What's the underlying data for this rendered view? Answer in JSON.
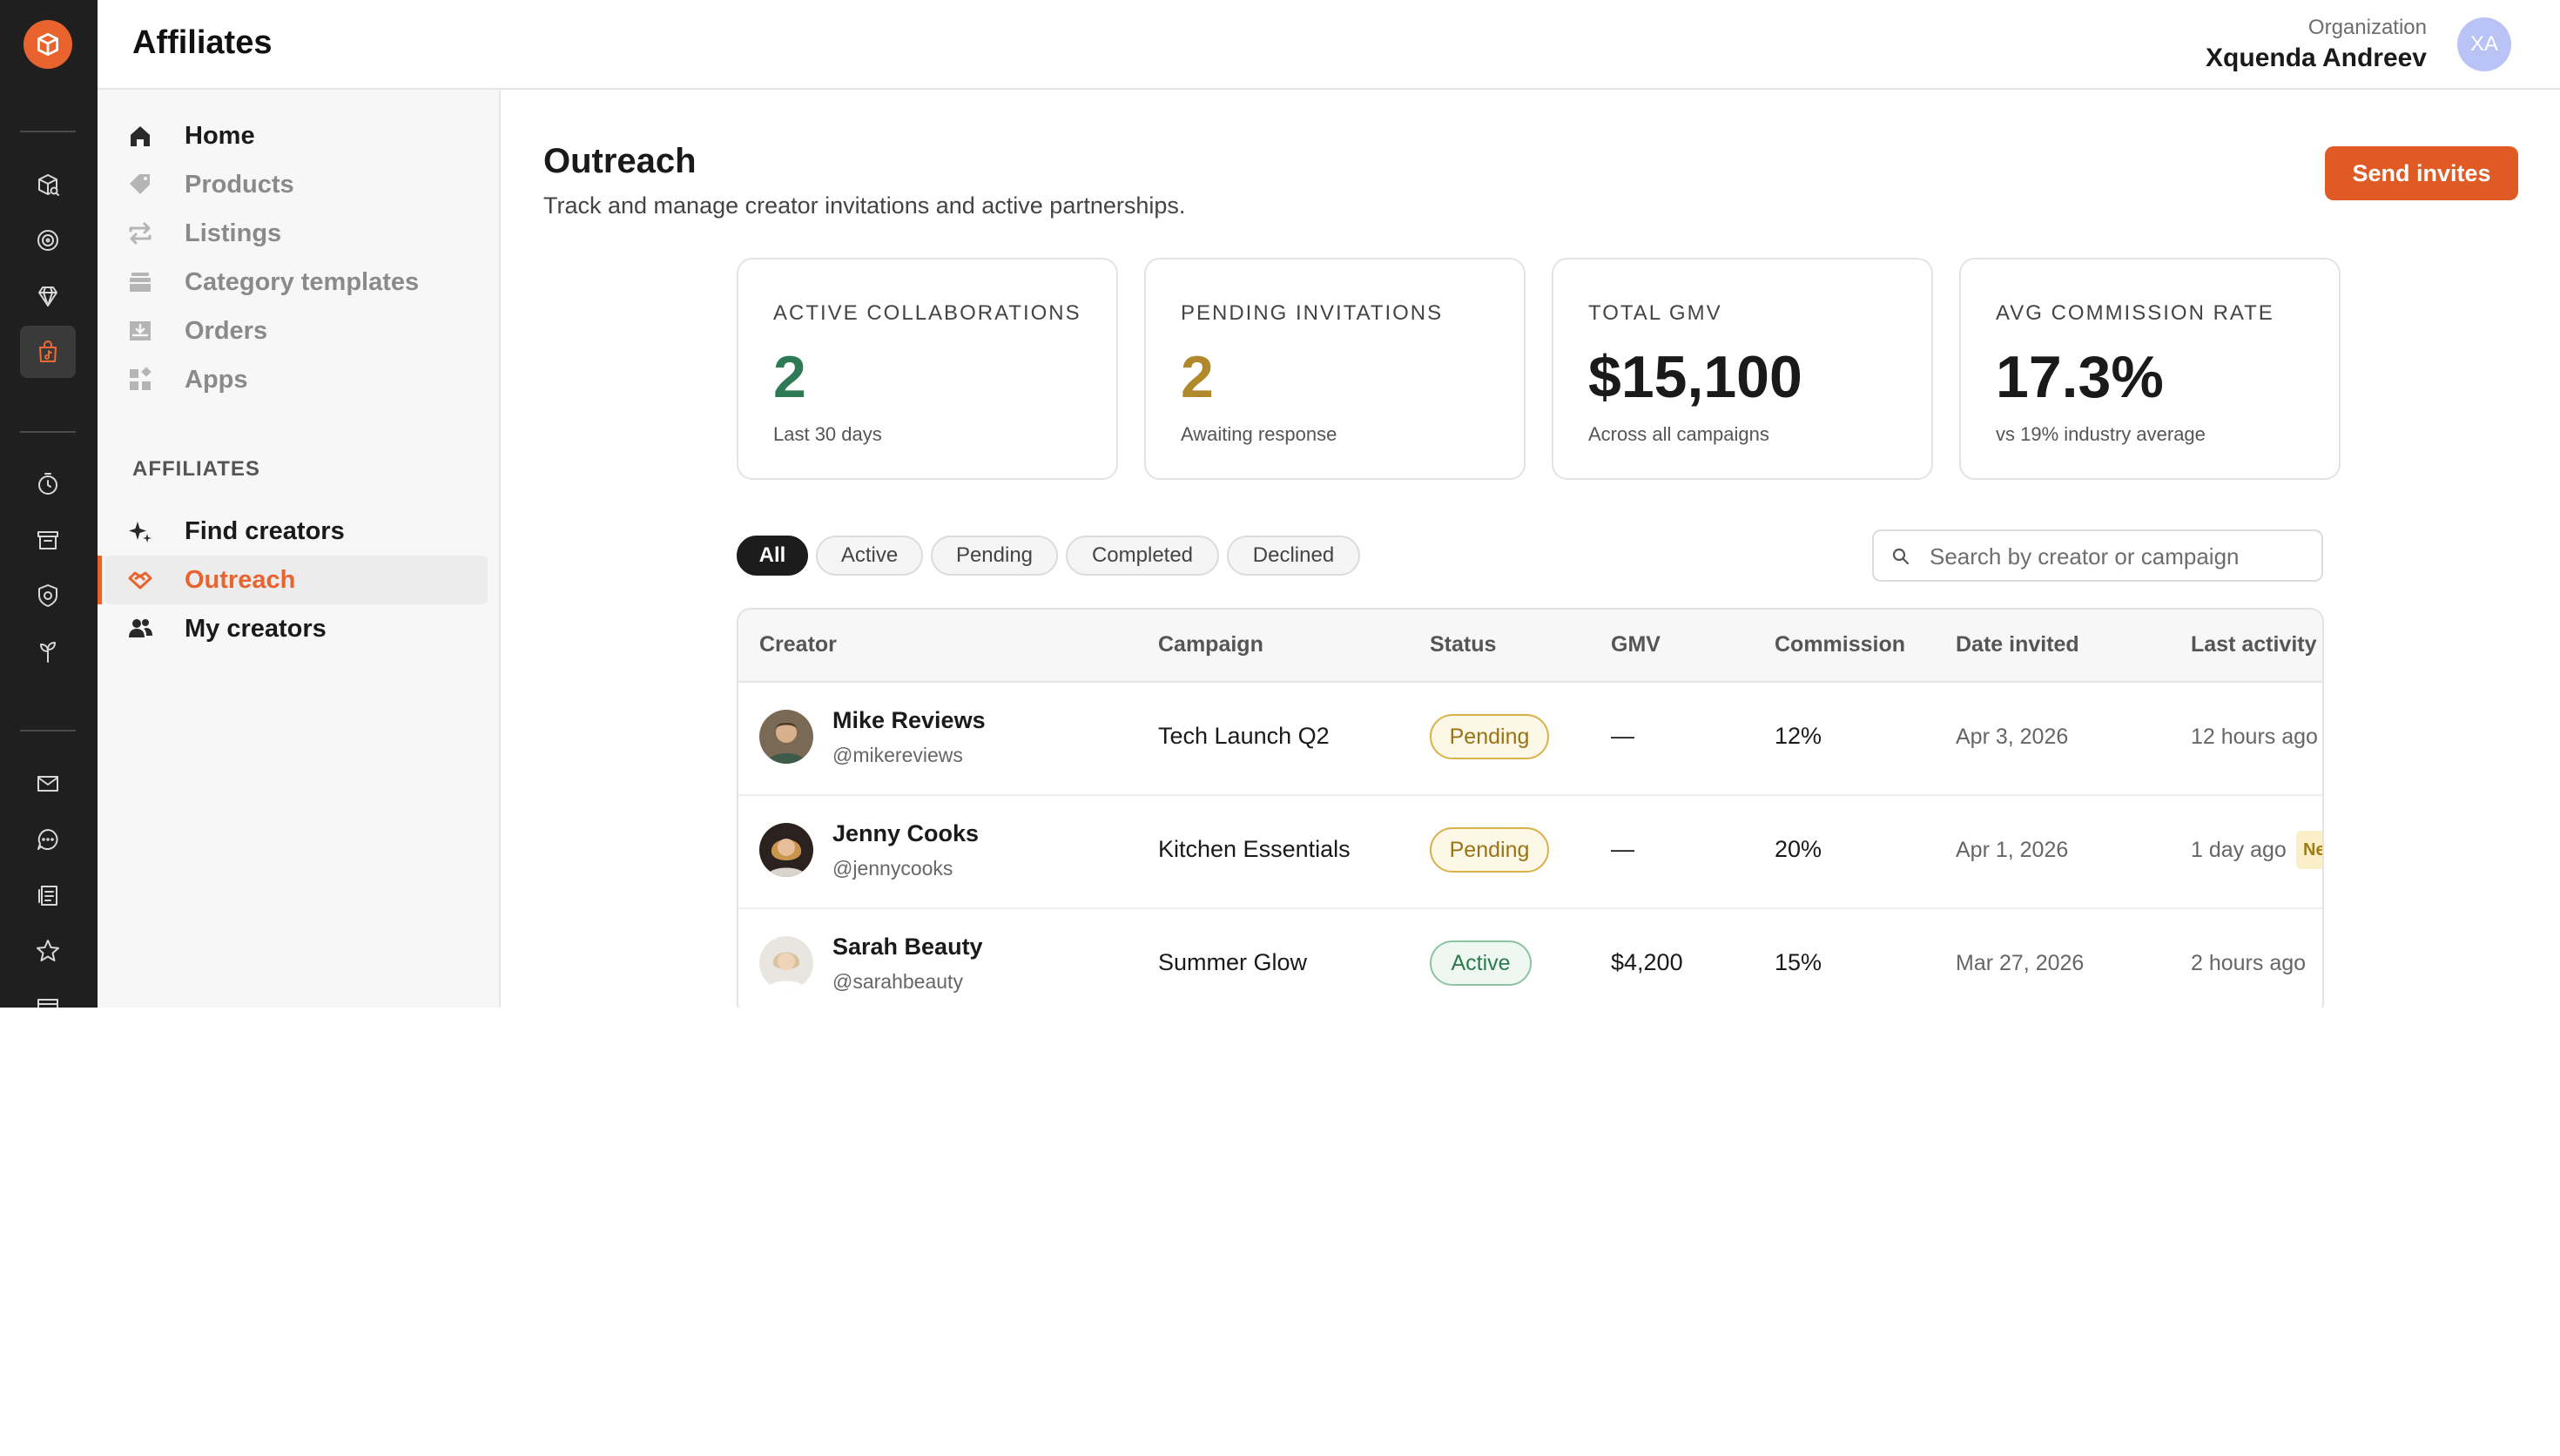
{
  "app": {
    "title": "Affiliates"
  },
  "org": {
    "label": "Organization",
    "name": "Xquenda Andreev",
    "initials": "XA"
  },
  "sidebar": {
    "items": [
      {
        "label": "Home"
      },
      {
        "label": "Products"
      },
      {
        "label": "Listings"
      },
      {
        "label": "Category templates"
      },
      {
        "label": "Orders"
      },
      {
        "label": "Apps"
      }
    ],
    "section_label": "AFFILIATES",
    "affiliate_items": [
      {
        "label": "Find creators"
      },
      {
        "label": "Outreach"
      },
      {
        "label": "My creators"
      }
    ]
  },
  "page": {
    "title": "Outreach",
    "subtitle": "Track and manage creator invitations and active partnerships.",
    "send_button": "Send invites"
  },
  "stats": [
    {
      "label": "ACTIVE COLLABORATIONS",
      "value": "2",
      "sub": "Last 30 days",
      "color": "#2e7a55"
    },
    {
      "label": "PENDING INVITATIONS",
      "value": "2",
      "sub": "Awaiting response",
      "color": "#b08a2a"
    },
    {
      "label": "TOTAL GMV",
      "value": "$15,100",
      "sub": "Across all campaigns",
      "color": "#1a1a1a"
    },
    {
      "label": "AVG COMMISSION RATE",
      "value": "17.3%",
      "sub": "vs 19% industry average",
      "color": "#1a1a1a"
    }
  ],
  "filters": {
    "all": "All",
    "active": "Active",
    "pending": "Pending",
    "completed": "Completed",
    "declined": "Declined",
    "selected": "All"
  },
  "search": {
    "placeholder": "Search by creator or campaign",
    "value": ""
  },
  "table": {
    "columns": [
      "Creator",
      "Campaign",
      "Status",
      "GMV",
      "Commission",
      "Date invited",
      "Last activity"
    ],
    "rows": [
      {
        "name": "Mike Reviews",
        "handle": "@mikereviews",
        "campaign": "Tech Launch Q2",
        "status": "Pending",
        "gmv": "—",
        "commission": "12%",
        "date_invited": "Apr 3, 2026",
        "last_activity": "12 hours ago"
      },
      {
        "name": "Jenny Cooks",
        "handle": "@jennycooks",
        "campaign": "Kitchen Essentials",
        "status": "Pending",
        "gmv": "—",
        "commission": "20%",
        "date_invited": "Apr 1, 2026",
        "last_activity": "1 day ago",
        "tag": "Ne"
      },
      {
        "name": "Sarah Beauty",
        "handle": "@sarahbeauty",
        "campaign": "Summer Glow",
        "status": "Active",
        "gmv": "$4,200",
        "commission": "15%",
        "date_invited": "Mar 27, 2026",
        "last_activity": "2 hours ago"
      }
    ]
  },
  "icons": {
    "rail": [
      "logo-icon",
      "package-search-icon",
      "target-icon",
      "diamond-icon",
      "shopping-bag-icon",
      "clock-icon",
      "archive-icon",
      "shield-icon",
      "plant-icon",
      "mail-icon",
      "chat-icon",
      "document-list-icon",
      "star-icon",
      "card-icon"
    ],
    "nav": [
      "home-icon",
      "tag-icon",
      "repeat-icon",
      "stack-icon",
      "download-tray-icon",
      "apps-icon",
      "sparkle-icon",
      "handshake-icon",
      "users-icon"
    ]
  },
  "colors": {
    "accent": "#e8632e",
    "rail_bg": "#1f1f1f",
    "active_green": "#2e7a55",
    "pending_gold": "#b08a2a"
  }
}
